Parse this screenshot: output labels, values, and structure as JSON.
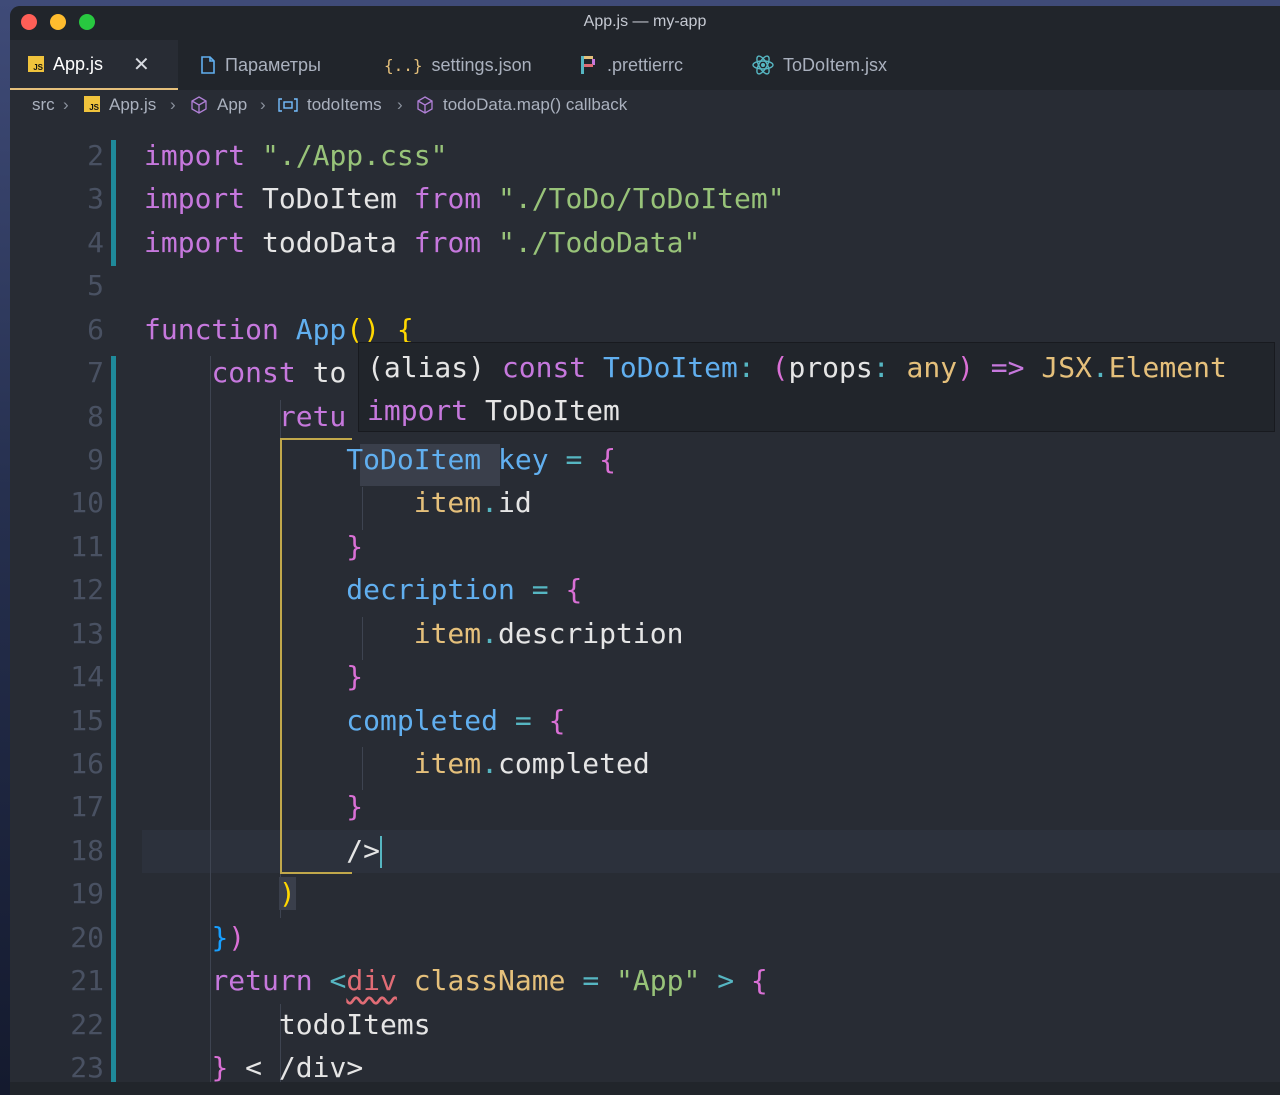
{
  "window": {
    "title": "App.js — my-app"
  },
  "tabs": [
    {
      "label": "App.js",
      "icon": "js-file-icon",
      "active": true
    },
    {
      "label": "Параметры",
      "icon": "file-icon"
    },
    {
      "label": "settings.json",
      "icon": "json-braces-icon"
    },
    {
      "label": ".prettierrc",
      "icon": "prettier-icon"
    },
    {
      "label": "ToDoItem.jsx",
      "icon": "react-icon"
    }
  ],
  "breadcrumb": [
    "src",
    "App.js",
    "App",
    "todoItems",
    "todoData.map() callback"
  ],
  "line_numbers": [
    "2",
    "3",
    "4",
    "5",
    "6",
    "7",
    "8",
    "9",
    "10",
    "11",
    "12",
    "13",
    "14",
    "15",
    "16",
    "17",
    "18",
    "19",
    "20",
    "21",
    "22",
    "23"
  ],
  "code": {
    "l2": {
      "kw": "import",
      "str": "\"./App.css\""
    },
    "l3": {
      "kw": "import",
      "id": "ToDoItem",
      "from": "from",
      "str": "\"./ToDo/ToDoItem\""
    },
    "l4": {
      "kw": "import",
      "id": "todoData",
      "from": "from",
      "str": "\"./TodoData\""
    },
    "l6": {
      "kw": "function",
      "fn": "App",
      "paren": "()",
      "brace": "{"
    },
    "l7": {
      "kw": "const",
      "id": "to"
    },
    "l8": {
      "kw": "retu"
    },
    "l9": {
      "tag": "ToDoItem",
      "attr": "key",
      "eq": "=",
      "brace": "{"
    },
    "l10": {
      "obj": "item",
      "dot": ".",
      "prop": "id"
    },
    "l11": {
      "brace": "}"
    },
    "l12": {
      "attr": "decription",
      "eq": "=",
      "brace": "{"
    },
    "l13": {
      "obj": "item",
      "dot": ".",
      "prop": "description"
    },
    "l14": {
      "brace": "}"
    },
    "l15": {
      "attr": "completed",
      "eq": "=",
      "brace": "{"
    },
    "l16": {
      "obj": "item",
      "dot": ".",
      "prop": "completed"
    },
    "l17": {
      "brace": "}"
    },
    "l18": {
      "close": "/>"
    },
    "l19": {
      "paren": ")"
    },
    "l20": {
      "brace": "}",
      "paren": ")"
    },
    "l21": {
      "kw": "return",
      "lt": "<",
      "tag": "div",
      "attr": "className",
      "eq": "=",
      "str": "\"App\"",
      "gt": ">",
      "brace": "{"
    },
    "l22": {
      "id": "todoItems"
    },
    "l23": {
      "brace": "}",
      "lt": "<",
      "close": "/div",
      "gt": ">"
    }
  },
  "hover": {
    "line1": {
      "alias": "(alias)",
      "kw": "const",
      "name": "ToDoItem",
      "colon": ":",
      "lp": "(",
      "param": "props",
      "colon2": ":",
      "type": "any",
      "rp": ")",
      "arrow": "=>",
      "ret": "JSX",
      "dot": ".",
      "elem": "Element"
    },
    "line2": {
      "kw": "import",
      "name": "ToDoItem"
    }
  },
  "colors": {
    "accent": "#1f8a9a",
    "background": "#282c34",
    "tab_active_border": "#e5c07b"
  }
}
